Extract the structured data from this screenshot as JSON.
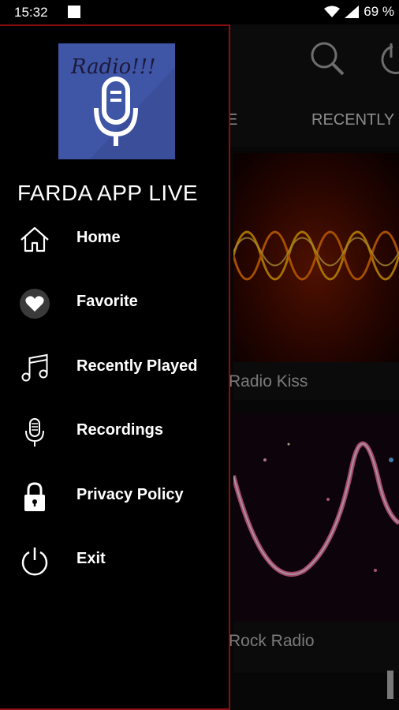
{
  "status_bar": {
    "time": "15:32",
    "battery": "69 %"
  },
  "background": {
    "tabs": [
      {
        "label": "E"
      },
      {
        "label": "RECENTLY"
      }
    ],
    "stations": [
      {
        "name": "Radio Kiss"
      },
      {
        "name": "Rock Radio"
      }
    ]
  },
  "drawer": {
    "logo_text": "Radio!!!",
    "app_title": "FARDA APP LIVE",
    "menu": [
      {
        "label": "Home",
        "icon": "home-icon"
      },
      {
        "label": "Favorite",
        "icon": "heart-icon"
      },
      {
        "label": "Recently Played",
        "icon": "music-note-icon"
      },
      {
        "label": "Recordings",
        "icon": "microphone-icon"
      },
      {
        "label": "Privacy Policy",
        "icon": "lock-icon"
      },
      {
        "label": "Exit",
        "icon": "power-icon"
      }
    ]
  },
  "colors": {
    "drawer_border": "#8a1010",
    "logo_bg": "#3f55a6"
  }
}
